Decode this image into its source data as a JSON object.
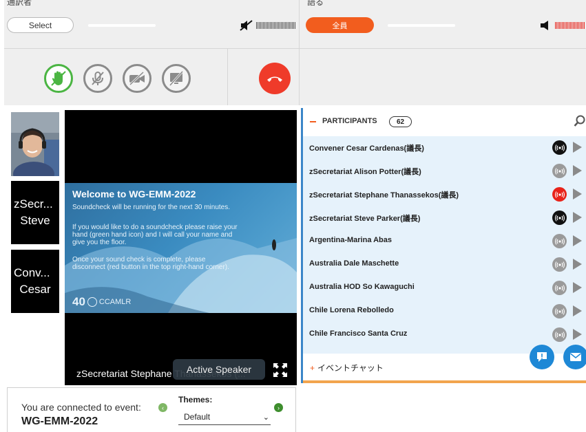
{
  "top": {
    "left_cut_label": "通訳者",
    "right_cut_label": "語る",
    "select_label": "Select",
    "all_label": "全員"
  },
  "controls": {
    "icons": [
      "raise-hand-icon",
      "mic-muted-icon",
      "camera-off-icon",
      "screen-share-off-icon",
      "hang-up-icon"
    ]
  },
  "tiles": [
    {
      "line1": "zSecr...",
      "line2": "Steve"
    },
    {
      "line1": "Conv...",
      "line2": "Cesar"
    }
  ],
  "slide": {
    "title": "Welcome to WG-EMM-2022",
    "p1": "Soundcheck will be running for the next 30 minutes.",
    "p2": "If you would like to do a soundcheck please raise your hand (green hand icon) and I will call your name and give you the floor.",
    "p3": "Once your sound check is complete, please disconnect (red button in the top right-hand corner).",
    "logo_number": "40",
    "logo_text": "CCAMLR"
  },
  "video": {
    "speaker_name": "zSecretariat Stephane Thanassekos (...",
    "active_speaker_label": "Active Speaker"
  },
  "participants": {
    "title": "PARTICIPANTS",
    "count": "62",
    "rows": [
      {
        "name": "Convener Cesar Cardenas(議長)",
        "audio": "black"
      },
      {
        "name": "zSecretariat Alison Potter(議長)",
        "audio": "gray"
      },
      {
        "name": "zSecretariat Stephane Thanassekos(議長)",
        "audio": "red"
      },
      {
        "name": "zSecretariat Steve Parker(議長)",
        "audio": "black"
      },
      {
        "name": "Argentina-Marina Abas",
        "audio": "gray"
      },
      {
        "name": "Australia Dale Maschette",
        "audio": "gray"
      },
      {
        "name": "Australia HOD So Kawaguchi",
        "audio": "gray"
      },
      {
        "name": "Chile Lorena Rebolledo",
        "audio": "gray"
      },
      {
        "name": "Chile Francisco Santa Cruz",
        "audio": "gray"
      }
    ],
    "chat_label": "イベントチャット"
  },
  "event": {
    "connected_label": "You are connected to event:",
    "event_name": "WG-EMM-2022",
    "themes_label": "Themes:",
    "themes_value": "Default"
  },
  "colors": {
    "accent_orange": "#f25d1e",
    "hangup_red": "#ef3b2a",
    "hand_green": "#4bb543",
    "panel_blue": "#e6f2fb",
    "fab_blue": "#1e88d6"
  }
}
